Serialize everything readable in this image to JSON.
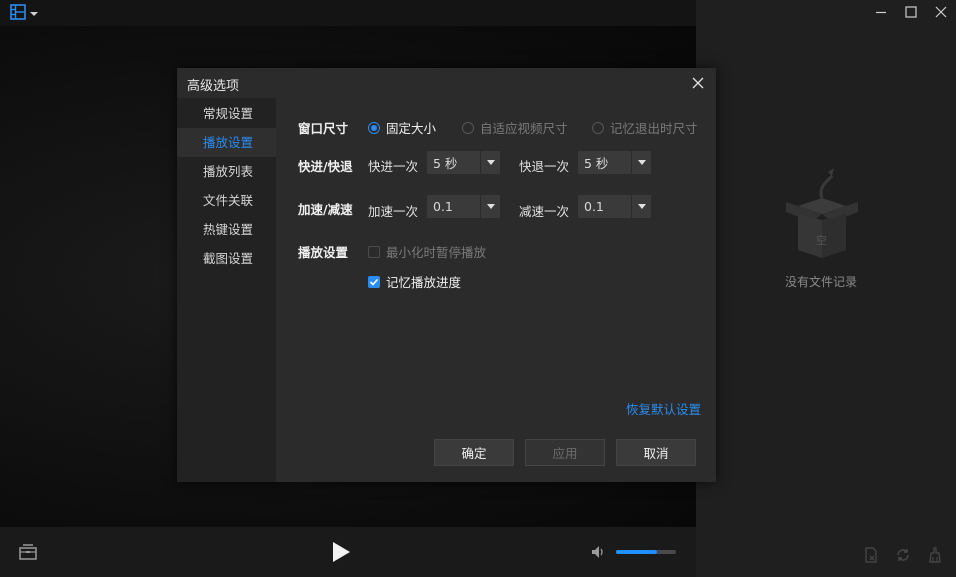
{
  "dialog": {
    "title": "高级选项",
    "nav": [
      {
        "label": "常规设置"
      },
      {
        "label": "播放设置"
      },
      {
        "label": "播放列表"
      },
      {
        "label": "文件关联"
      },
      {
        "label": "热键设置"
      },
      {
        "label": "截图设置"
      }
    ],
    "active_nav": "播放设置",
    "window_size": {
      "label": "窗口尺寸",
      "options": [
        {
          "label": "固定大小",
          "selected": true
        },
        {
          "label": "自适应视频尺寸",
          "selected": false
        },
        {
          "label": "记忆退出时尺寸",
          "selected": false
        }
      ]
    },
    "seek": {
      "label": "快进/快退",
      "forward_label": "快进一次",
      "forward_value": "5 秒",
      "backward_label": "快退一次",
      "backward_value": "5 秒"
    },
    "speed": {
      "label": "加速/减速",
      "up_label": "加速一次",
      "up_value": "0.1",
      "down_label": "减速一次",
      "down_value": "0.1"
    },
    "playback": {
      "label": "播放设置",
      "pause_on_minimize": {
        "label": "最小化时暂停播放",
        "checked": false
      },
      "remember_progress": {
        "label": "记忆播放进度",
        "checked": true
      }
    },
    "restore_defaults": "恢复默认设置",
    "buttons": {
      "ok": "确定",
      "apply": "应用",
      "cancel": "取消"
    }
  },
  "playlist": {
    "empty_text": "没有文件记录",
    "empty_box_label": "空"
  },
  "player": {
    "volume": 0.68
  },
  "colors": {
    "accent": "#2a8cf0",
    "volume": "#1e90ff"
  },
  "icons": {
    "app_menu": "film-strip-icon",
    "dropdown": "caret-down-icon",
    "minimize": "minimize-icon",
    "maximize": "maximize-icon",
    "close": "close-icon",
    "media_library": "media-library-icon",
    "play": "play-icon",
    "volume": "speaker-icon",
    "playlist_tools": [
      "delete-file-icon",
      "loop-icon",
      "clean-icon"
    ]
  }
}
